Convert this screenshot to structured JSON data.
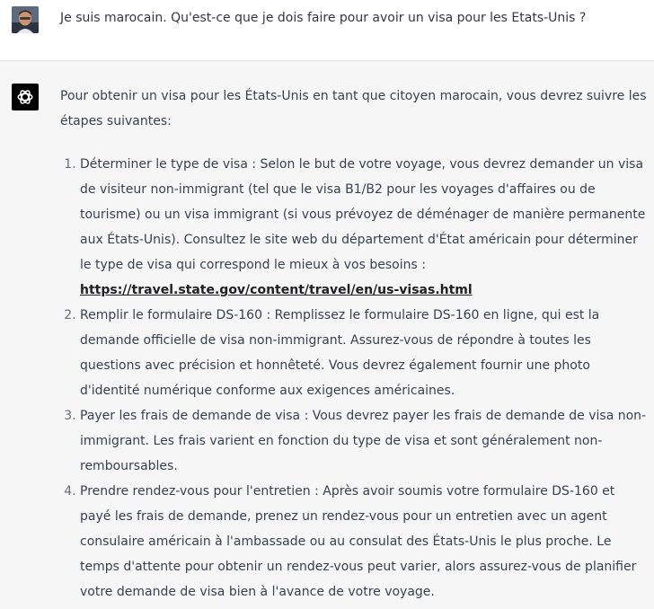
{
  "user_message": {
    "text": "Je suis marocain. Qu'est-ce que je dois faire pour avoir un visa pour les Etats-Unis ?",
    "avatar_icon": "user-photo-avatar"
  },
  "assistant_message": {
    "avatar_icon": "openai-logo-icon",
    "intro": "Pour obtenir un visa pour les États-Unis en tant que citoyen marocain, vous devrez suivre les étapes suivantes:",
    "steps": [
      {
        "text": "Déterminer le type de visa : Selon le but de votre voyage, vous devrez demander un visa de visiteur non-immigrant (tel que le visa B1/B2 pour les voyages d'affaires ou de tourisme) ou un visa immigrant (si vous prévoyez de déménager de manière permanente aux États-Unis). Consultez le site web du département d'État américain pour déterminer le type de visa qui correspond le mieux à vos besoins :",
        "link": "https://travel.state.gov/content/travel/en/us-visas.html"
      },
      {
        "text": "Remplir le formulaire DS-160 : Remplissez le formulaire DS-160 en ligne, qui est la demande officielle de visa non-immigrant. Assurez-vous de répondre à toutes les questions avec précision et honnêteté. Vous devrez également fournir une photo d'identité numérique conforme aux exigences américaines."
      },
      {
        "text": "Payer les frais de demande de visa : Vous devrez payer les frais de demande de visa non-immigrant. Les frais varient en fonction du type de visa et sont généralement non-remboursables."
      },
      {
        "text": "Prendre rendez-vous pour l'entretien : Après avoir soumis votre formulaire DS-160 et payé les frais de demande, prenez un rendez-vous pour un entretien avec un agent consulaire américain à l'ambassade ou au consulat des États-Unis le plus proche. Le temps d'attente pour obtenir un rendez-vous peut varier, alors assurez-vous de planifier votre demande de visa bien à l'avance de votre voyage."
      }
    ]
  },
  "colors": {
    "user_bg": "#ffffff",
    "assistant_bg": "#f7f7f8",
    "text": "#374151",
    "bot_avatar_bg": "#000000"
  }
}
